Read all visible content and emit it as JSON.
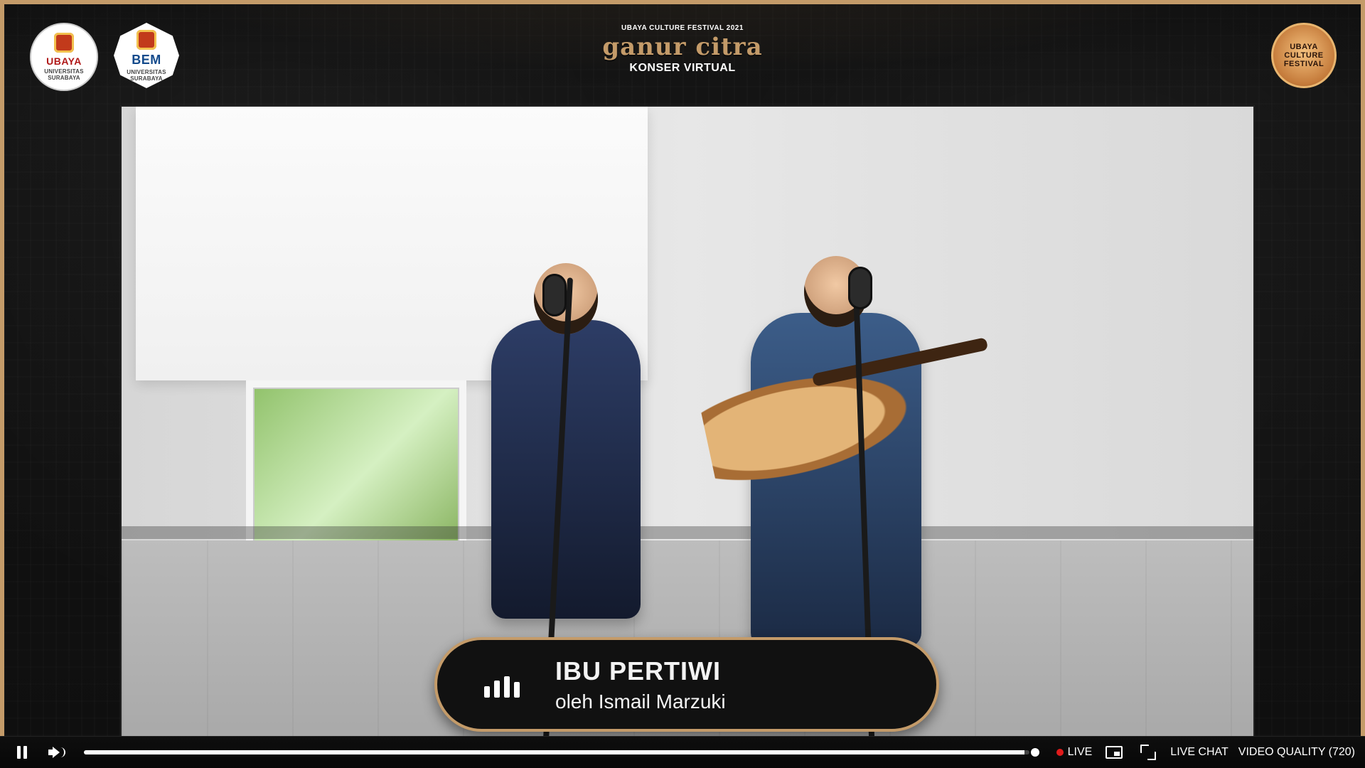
{
  "header": {
    "left_logo_1": "UBAYA",
    "left_logo_1_small": "UNIVERSITAS SURABAYA",
    "left_logo_2": "BEM",
    "left_logo_2_small": "UNIVERSITAS SURABAYA",
    "event_small": "UBAYA CULTURE FESTIVAL 2021",
    "event_title": "ganur citra",
    "event_subtitle": "KONSER VIRTUAL",
    "right_logo": "UBAYA CULTURE FESTIVAL"
  },
  "overlay": {
    "song_title": "IBU PERTIWI",
    "song_subtitle": "oleh Ismail Marzuki"
  },
  "controls": {
    "live_label": "LIVE",
    "live_chat_label": "LIVE CHAT",
    "video_quality_label": "VIDEO QUALITY (720)",
    "progress_fraction": 0.995
  },
  "colors": {
    "accent": "#c49b69",
    "live": "#e11b1b"
  },
  "icons": {
    "pause": "pause-icon",
    "volume": "speaker-icon",
    "picture_in_picture": "pip-icon",
    "minimize": "minimize-icon",
    "equalizer": "equalizer-icon"
  }
}
